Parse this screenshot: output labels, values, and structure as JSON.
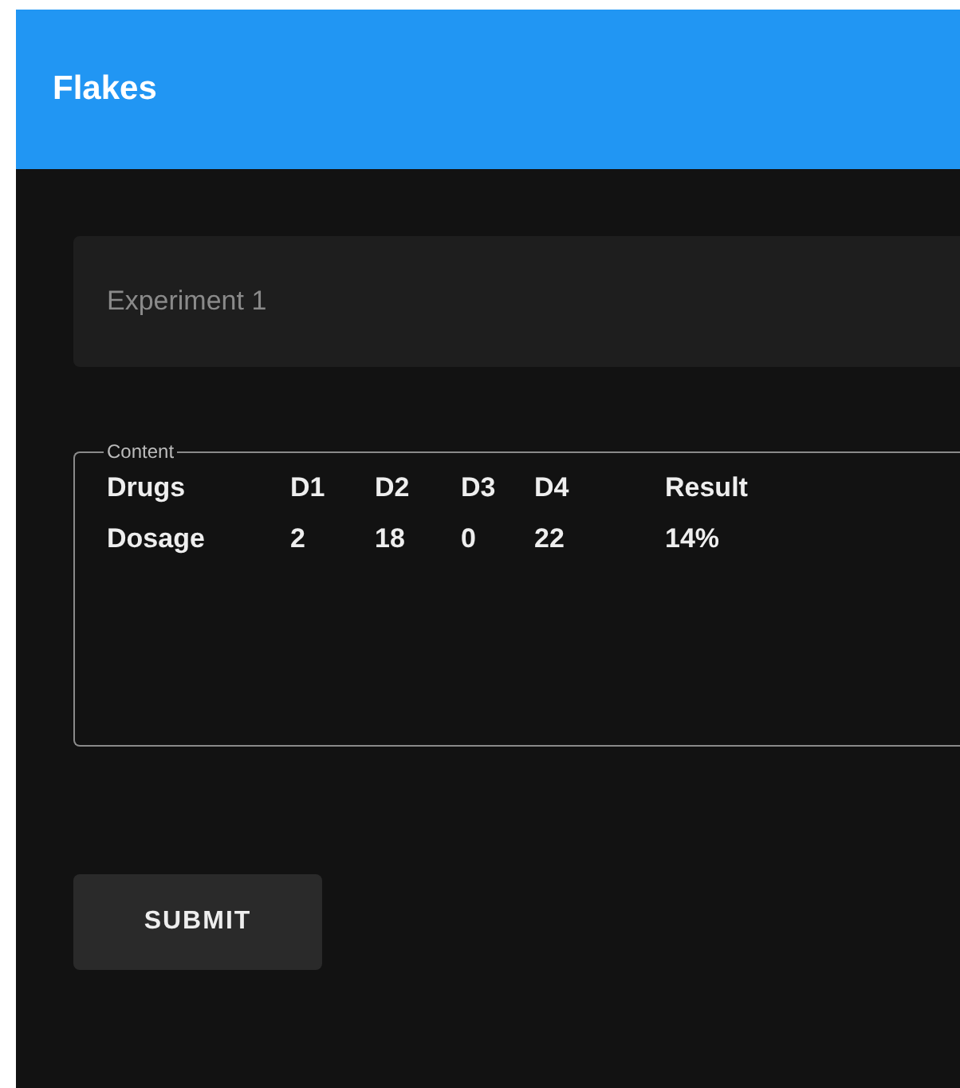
{
  "app_bar": {
    "title": "Flakes"
  },
  "name_field": {
    "placeholder": "Experiment 1"
  },
  "content": {
    "legend": "Content",
    "rows": [
      {
        "cells": [
          "Drugs",
          "D1",
          "D2",
          "D3",
          "D4",
          "Result"
        ]
      },
      {
        "cells": [
          "Dosage",
          "2",
          "18",
          "0",
          "22",
          "14%"
        ]
      }
    ]
  },
  "submit_button": {
    "label": "SUBMIT"
  }
}
